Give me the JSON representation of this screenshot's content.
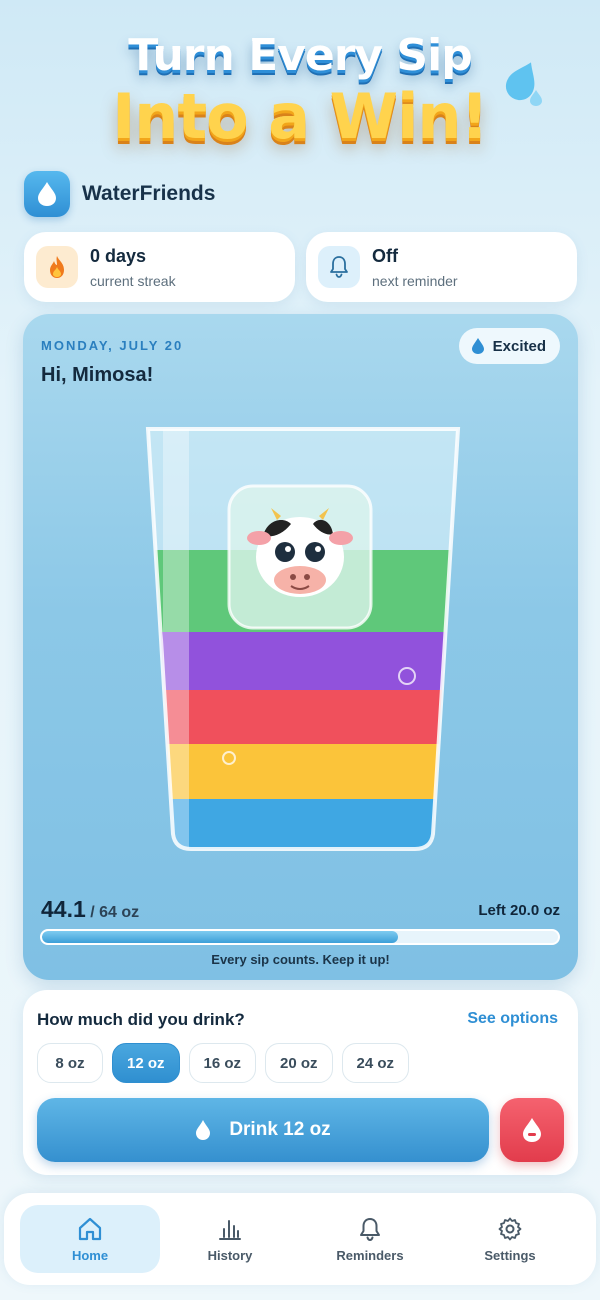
{
  "colors": {
    "accent": "#2f8fd4",
    "danger": "#e23c4c",
    "hero_yellow": "#ffd34d"
  },
  "hero": {
    "line1": "Turn Every Sip",
    "line2": "Into a Win!"
  },
  "app": {
    "name": "WaterFriends",
    "icon": "water-drop-icon"
  },
  "stats": [
    {
      "value": "0 days",
      "label": "current streak",
      "icon": "flame-icon"
    },
    {
      "value": "Off",
      "label": "next reminder",
      "icon": "bell-icon"
    }
  ],
  "today": {
    "date": "MONDAY, JULY 20",
    "greeting": "Hi, Mimosa!",
    "mood": "Excited",
    "mascot": "cow-mascot"
  },
  "progress": {
    "amount": "44.1",
    "goal": "/ 64 oz",
    "left": "Left 20.0 oz",
    "fraction": 0.69,
    "message": "Every sip counts. Keep it up!"
  },
  "drink": {
    "question": "How much did you drink?",
    "see_options": "See options",
    "options": [
      "8 oz",
      "12 oz",
      "16 oz",
      "20 oz",
      "24 oz"
    ],
    "selected": "12 oz",
    "button_label": "Drink 12 oz"
  },
  "tabs": [
    {
      "label": "Home",
      "icon": "home-icon",
      "active": true
    },
    {
      "label": "History",
      "icon": "chart-icon",
      "active": false
    },
    {
      "label": "Reminders",
      "icon": "bell-icon",
      "active": false
    },
    {
      "label": "Settings",
      "icon": "gear-icon",
      "active": false
    }
  ]
}
